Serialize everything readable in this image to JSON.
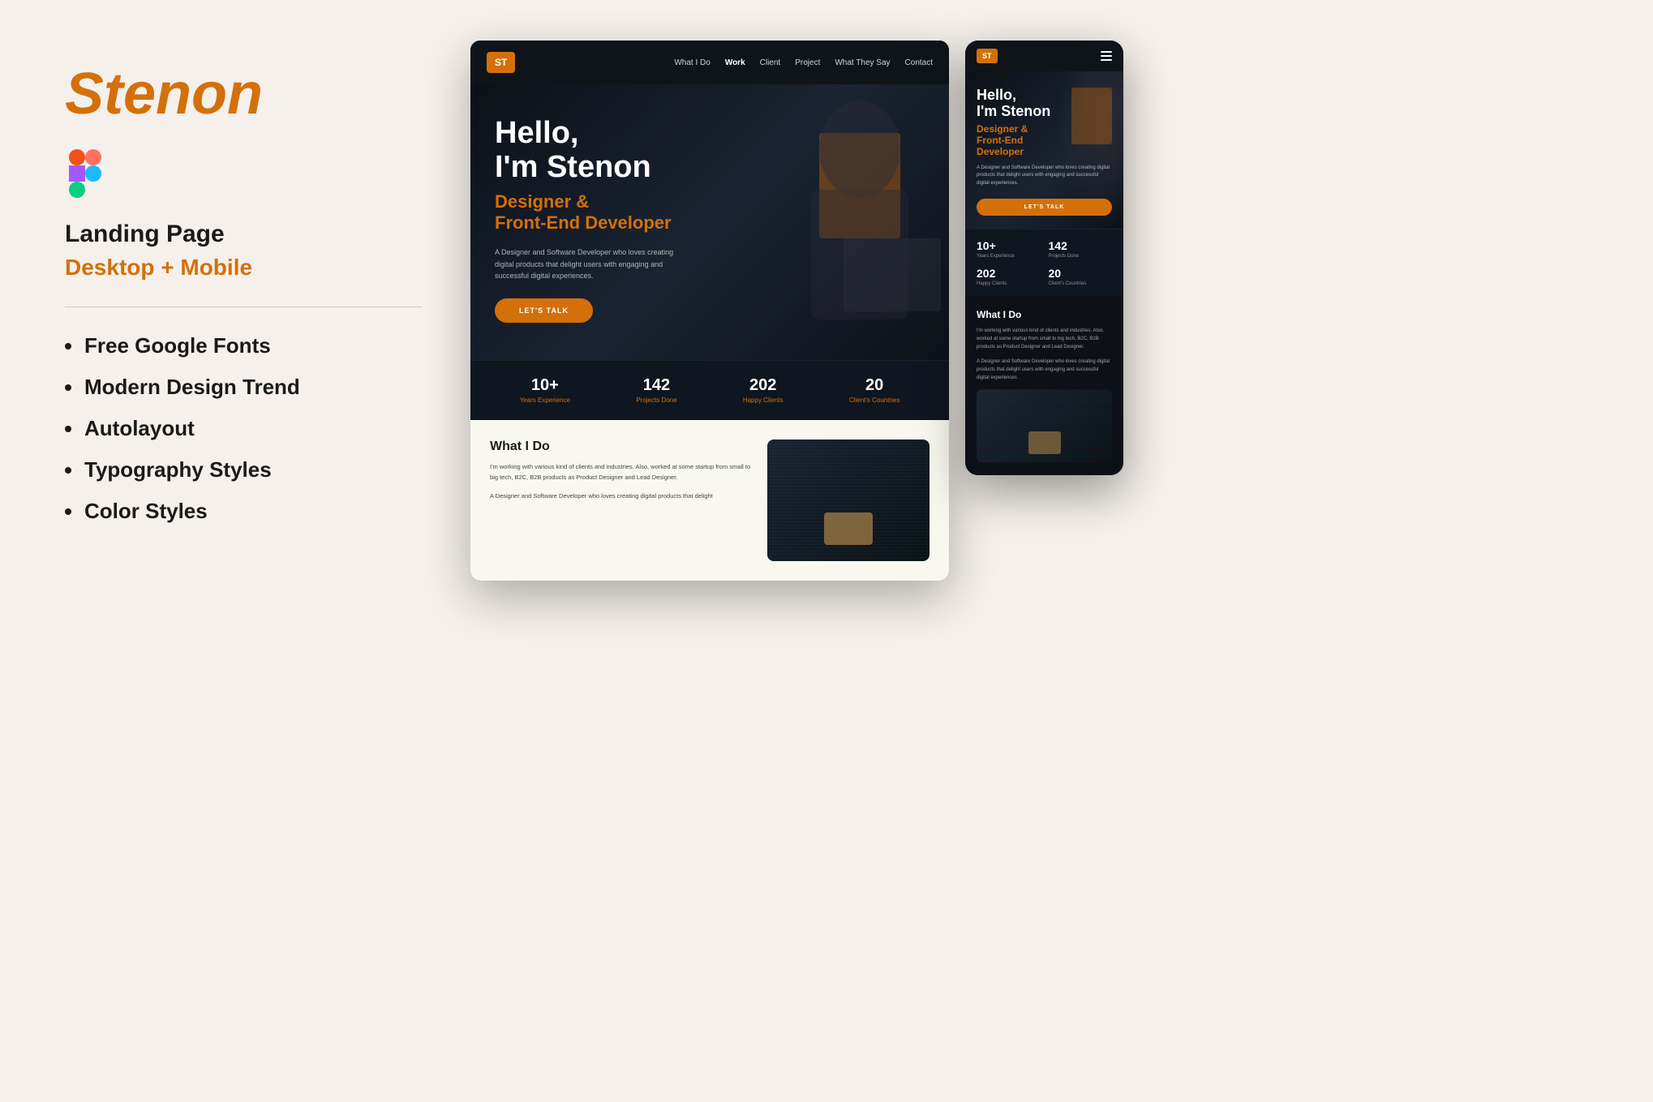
{
  "brand": {
    "name": "Stenon",
    "figma_icon": "figma-icon"
  },
  "left_panel": {
    "product_type": "Landing Page",
    "product_variant": "Desktop + Mobile",
    "features": [
      "Free Google Fonts",
      "Modern Design Trend",
      "Autolayout",
      "Typography Styles",
      "Color Styles"
    ]
  },
  "desktop_mockup": {
    "nav": {
      "logo": "ST",
      "links": [
        "What I Do",
        "Work",
        "Client",
        "Project",
        "What They Say",
        "Contact"
      ]
    },
    "hero": {
      "title": "Hello,\nI'm Stenon",
      "subtitle": "Designer &\nFront-End Developer",
      "description": "A Designer and Software Developer who loves creating digital products that delight users with engaging and successful digital experiences.",
      "cta": "LET'S TALK"
    },
    "stats": [
      {
        "number": "10+",
        "label": "Years Experience"
      },
      {
        "number": "142",
        "label": "Projects Done"
      },
      {
        "number": "202",
        "label": "Happy Clients"
      },
      {
        "number": "20",
        "label": "Client's Countries"
      }
    ],
    "what_i_do": {
      "title": "What I Do",
      "desc1": "I'm working with various kind of clients and industries. Also, worked at some startup from small to big tech, B2C, B2B products as Product Designer and Lead Designer.",
      "desc2": "A Designer and Software Developer who loves creating digital products that delight"
    }
  },
  "mobile_mockup": {
    "nav": {
      "logo": "ST"
    },
    "hero": {
      "title": "Hello,\nI'm Stenon",
      "subtitle": "Designer &\nFront-End\nDeveloper",
      "description": "A Designer and Software Developer who loves creating digital products that delight users with engaging and successful digital experiences.",
      "cta": "LET'S TALK"
    },
    "stats": [
      {
        "number": "10+",
        "label": "Years Experience"
      },
      {
        "number": "142",
        "label": "Projects Done"
      },
      {
        "number": "202",
        "label": "Happy Clients"
      },
      {
        "number": "20",
        "label": "Client's Countries"
      }
    ],
    "what_i_do": {
      "title": "What I Do",
      "desc1": "I'm working with various kind of clients and industries. Also, worked at some startup from small to big tech, B2C, B2B products as Product Designer and Lead Designer.",
      "desc2": "A Designer and Software Developer who loves creating digital products that delight users with engaging and successful digital experiences"
    }
  },
  "colors": {
    "accent": "#d4700a",
    "dark_bg": "#0d1117",
    "light_bg": "#f5f0eb"
  }
}
